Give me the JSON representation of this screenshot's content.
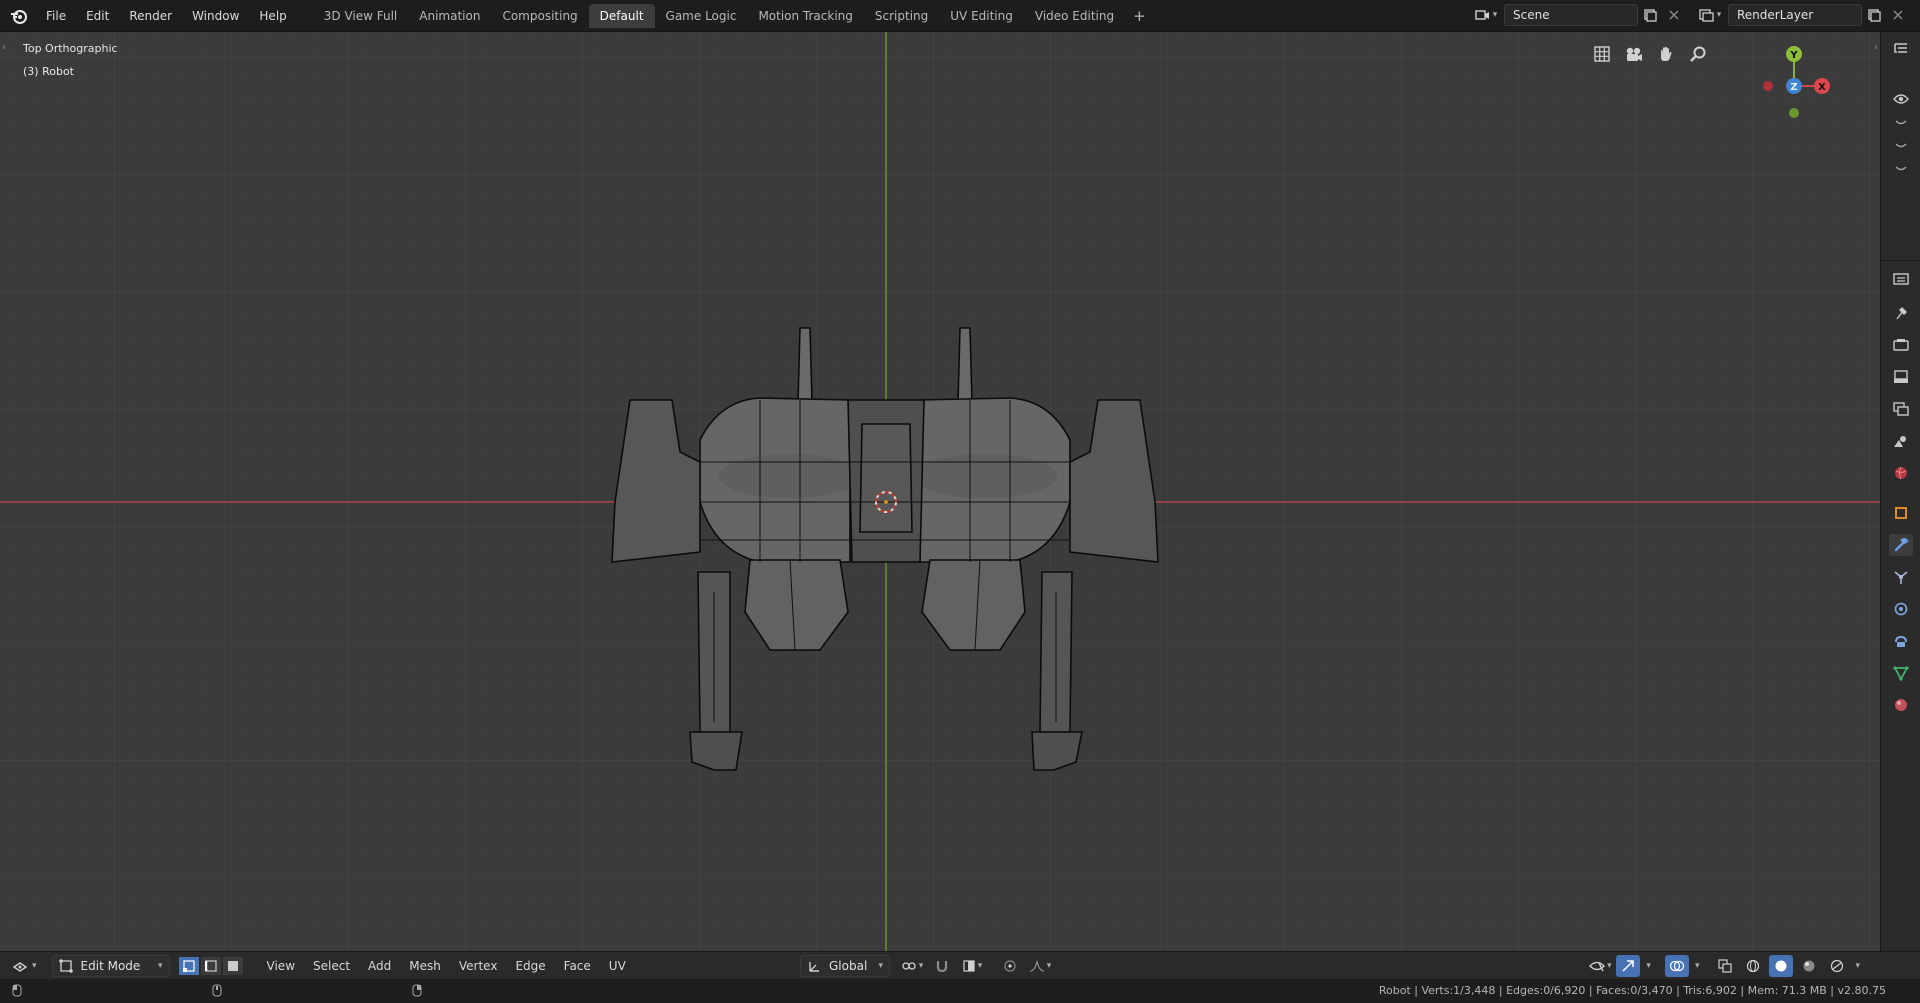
{
  "top_menu": {
    "items": [
      "File",
      "Edit",
      "Render",
      "Window",
      "Help"
    ]
  },
  "workspaces": {
    "tabs": [
      "3D View Full",
      "Animation",
      "Compositing",
      "Default",
      "Game Logic",
      "Motion Tracking",
      "Scripting",
      "UV Editing",
      "Video Editing"
    ],
    "active": "Default",
    "add_symbol": "+"
  },
  "scene": {
    "name": "Scene"
  },
  "render_layer": {
    "name": "RenderLayer"
  },
  "viewport": {
    "view_name": "Top Orthographic",
    "object_label": "(3) Robot",
    "gizmo": {
      "y": "Y",
      "z": "Z",
      "x": "X"
    }
  },
  "bottom_header": {
    "mode": "Edit Mode",
    "menus": [
      "View",
      "Select",
      "Add",
      "Mesh",
      "Vertex",
      "Edge",
      "Face",
      "UV"
    ],
    "transform_orientation": "Global"
  },
  "status_bar": {
    "stats": "Robot | Verts:1/3,448 | Edges:0/6,920 | Faces:0/3,470 | Tris:6,902 | Mem: 71.3 MB | v2.80.75"
  },
  "colors": {
    "viewport_bg": "#3b3b3b",
    "x_axis": "#b04448",
    "y_axis": "#6a9a2c",
    "active_tab": "#3d3d3d",
    "selected_toggle": "#4772b3"
  }
}
